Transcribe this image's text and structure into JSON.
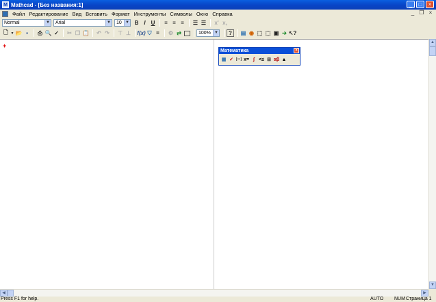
{
  "window": {
    "title": "Mathcad - [Без названия:1]"
  },
  "menu": [
    "Файл",
    "Редактирование",
    "Вид",
    "Вставить",
    "Формат",
    "Инструменты",
    "Символы",
    "Окно",
    "Справка"
  ],
  "format_toolbar": {
    "style": "Normal",
    "font": "Arial",
    "size": "10",
    "bold": "B",
    "italic": "I",
    "underline": "U"
  },
  "standard_toolbar": {
    "zoom": "100%",
    "help_label": "?"
  },
  "palette": {
    "title": "Математика",
    "icons": [
      {
        "name": "calculator-palette-icon",
        "glyph": "▦",
        "color": "#2a6fb0"
      },
      {
        "name": "graph-palette-icon",
        "glyph": "✓",
        "color": "#c00000"
      },
      {
        "name": "matrix-palette-icon",
        "glyph": "[:::]",
        "color": "#333333"
      },
      {
        "name": "evaluation-palette-icon",
        "glyph": "x=",
        "color": "#000000"
      },
      {
        "name": "calculus-palette-icon",
        "glyph": "∫",
        "color": "#b00000"
      },
      {
        "name": "boolean-palette-icon",
        "glyph": "<≤",
        "color": "#000000"
      },
      {
        "name": "programming-palette-icon",
        "glyph": "⊞",
        "color": "#333333"
      },
      {
        "name": "greek-palette-icon",
        "glyph": "αβ",
        "color": "#b00000"
      },
      {
        "name": "symbolic-palette-icon",
        "glyph": "▲",
        "color": "#000000"
      }
    ]
  },
  "status": {
    "help": "Press F1 for help.",
    "auto": "AUTO",
    "num": "NUM",
    "page": "Страница 1"
  },
  "colors": {
    "titlebar": "#0a4fd8",
    "cursor": "#e00000",
    "background": "#ffffff"
  }
}
